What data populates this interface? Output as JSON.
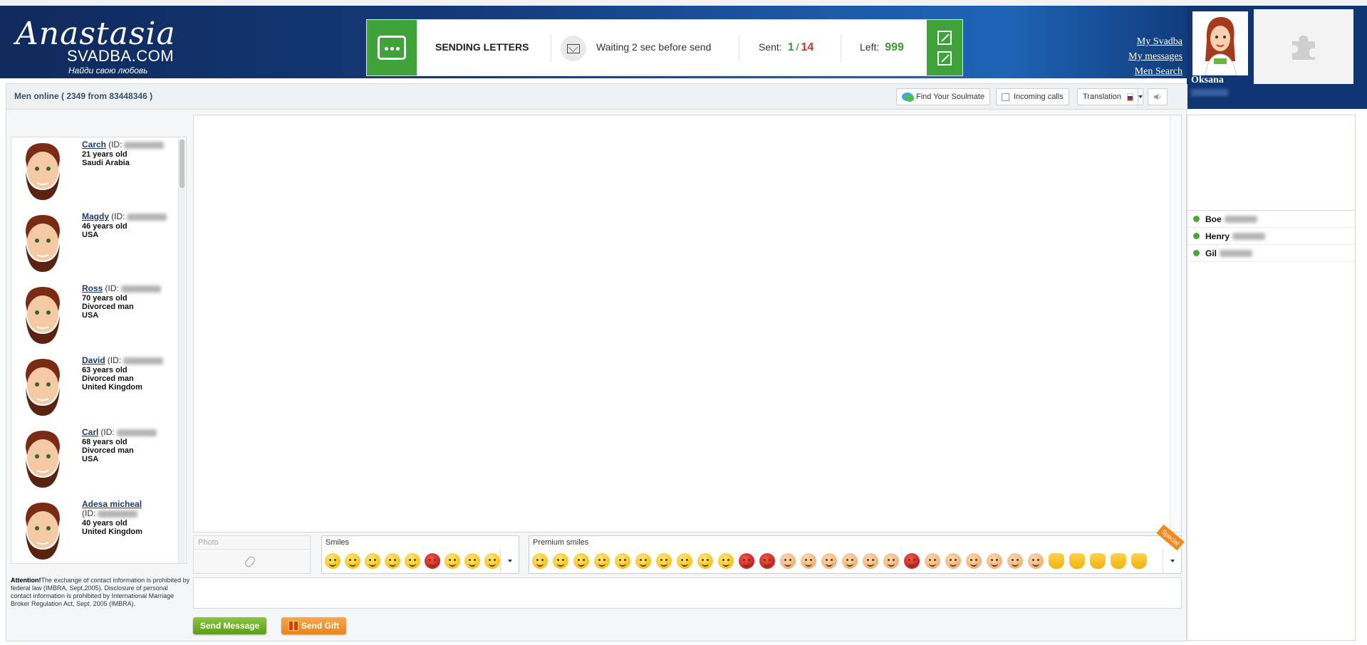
{
  "logo": {
    "script": "Anastasia",
    "domain": "SVADBA.COM",
    "slogan": "Найди свою любовь"
  },
  "sending": {
    "title": "SENDING LETTERS",
    "status": "Waiting 2 sec before send",
    "sent_label": "Sent:",
    "sent_value": "1",
    "sent_separator": "/",
    "sent_total": "14",
    "left_label": "Left:",
    "left_value": "999"
  },
  "top_links": [
    "My Svadba",
    "My messages",
    "Men Search"
  ],
  "profile": {
    "name": "Oksana"
  },
  "toolbar": {
    "online_text": "Men online ( 2349 from 83448346 )",
    "find_soulmate": "Find Your Soulmate",
    "incoming_calls": "Incoming calls",
    "translation": "Translation"
  },
  "men": [
    {
      "name": "Carch",
      "id_label": "(ID:",
      "lines": [
        "21 years old",
        "Saudi Arabia"
      ]
    },
    {
      "name": "Magdy",
      "id_label": "(ID:",
      "lines": [
        "46 years old",
        "USA"
      ]
    },
    {
      "name": "Ross",
      "id_label": "(ID:",
      "lines": [
        "70 years old",
        "Divorced man",
        "USA"
      ]
    },
    {
      "name": "David",
      "id_label": "(ID:",
      "lines": [
        "63 years old",
        "Divorced man",
        "United Kingdom"
      ]
    },
    {
      "name": "Carl",
      "id_label": "(ID:",
      "lines": [
        "68 years old",
        "Divorced man",
        "USA"
      ]
    },
    {
      "name": "Adesa micheal",
      "id_label": "(ID:",
      "lines": [
        "40 years old",
        "United Kingdom"
      ]
    }
  ],
  "attention": {
    "bold": "Attention!",
    "text": "The exchange of contact information is prohibited by federal law (IMBRA, Sept.2005). Disclosure of personal contact information is prohibited by International Marriage Broker Regulation Act, Sept. 2005 (IMBRA)."
  },
  "composer": {
    "photo_label": "Photo",
    "smiles_label": "Smiles",
    "premium_label": "Premium smiles",
    "special_badge": "Special"
  },
  "buttons": {
    "send_message": "Send Message",
    "send_gift": "Send Gift"
  },
  "contacts": [
    {
      "name": "Boe"
    },
    {
      "name": "Henry"
    },
    {
      "name": "Gil"
    }
  ],
  "colors": {
    "accent_green": "#3fa23a",
    "header_blue": "#143a7a",
    "sent_red": "#c0392b"
  }
}
